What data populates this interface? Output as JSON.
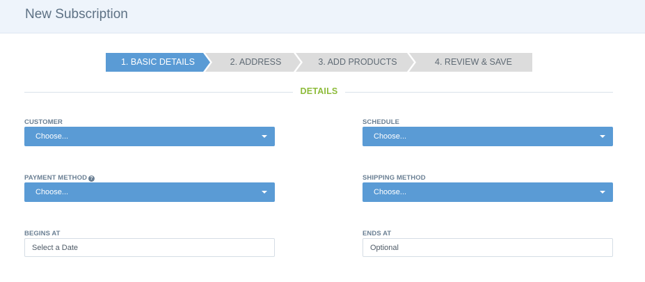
{
  "header": {
    "title": "New Subscription"
  },
  "wizard": {
    "steps": [
      {
        "label": "1. BASIC DETAILS",
        "active": true
      },
      {
        "label": "2. ADDRESS",
        "active": false
      },
      {
        "label": "3. ADD PRODUCTS",
        "active": false
      },
      {
        "label": "4. REVIEW & SAVE",
        "active": false
      }
    ]
  },
  "section": {
    "title": "DETAILS"
  },
  "form": {
    "customer": {
      "label": "CUSTOMER",
      "value": "Choose..."
    },
    "schedule": {
      "label": "SCHEDULE",
      "value": "Choose..."
    },
    "payment_method": {
      "label": "PAYMENT METHOD",
      "value": "Choose...",
      "help_icon": "?"
    },
    "shipping_method": {
      "label": "SHIPPING METHOD",
      "value": "Choose..."
    },
    "begins_at": {
      "label": "BEGINS AT",
      "placeholder": "Select a Date"
    },
    "ends_at": {
      "label": "ENDS AT",
      "placeholder": "Optional"
    }
  },
  "colors": {
    "accent": "#5a9bd5",
    "section_title": "#8dbb3a",
    "header_bg": "#eef4fb",
    "step_inactive": "#dcdcdc"
  }
}
